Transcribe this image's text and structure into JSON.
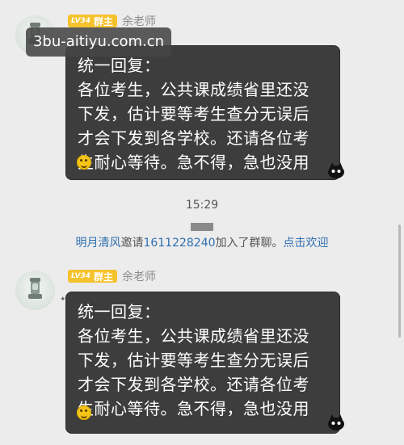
{
  "watermark": "3bu-aitiyu.com.cn",
  "messages": [
    {
      "level": "LV34",
      "role": "群主",
      "sender": "余老师",
      "lines": [
        "统一回复：",
        "各位考生，公共课成绩省里还没",
        "下发，估计要等考生查分无误后",
        "才会下发到各学校。还请各位考",
        "生耐心等待。急不得，急也没用"
      ],
      "emoji_icon": "smile-emoji-icon"
    },
    {
      "level": "LV34",
      "role": "群主",
      "sender": "余老师",
      "lines": [
        "统一回复：",
        "各位考生，公共课成绩省里还没",
        "下发，估计要等考生查分无误后",
        "才会下发到各学校。还请各位考",
        "生耐心等待。急不得，急也没用"
      ],
      "emoji_icon": "smile-emoji-icon"
    }
  ],
  "timestamp": "15:29",
  "system_notice": {
    "user": "明月清风",
    "invite_text": "邀请",
    "invitee": "1611228240",
    "joined_text": "加入了群聊。",
    "welcome_link": "点击欢迎"
  },
  "colors": {
    "bubble": "#3d3d3d",
    "badge": "#f4c22c",
    "link": "#2f6fb0",
    "background": "#ececec"
  }
}
